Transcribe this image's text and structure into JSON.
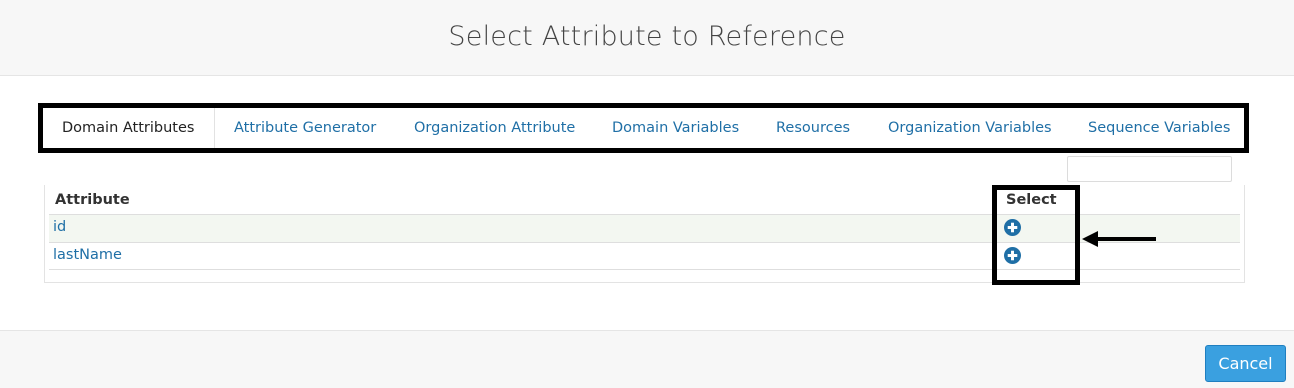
{
  "dialog": {
    "title": "Select Attribute to Reference"
  },
  "tabs": [
    {
      "label": "Domain Attributes",
      "active": true
    },
    {
      "label": "Attribute Generator",
      "active": false
    },
    {
      "label": "Organization Attribute",
      "active": false
    },
    {
      "label": "Domain Variables",
      "active": false
    },
    {
      "label": "Resources",
      "active": false
    },
    {
      "label": "Organization Variables",
      "active": false
    },
    {
      "label": "Sequence Variables",
      "active": false
    }
  ],
  "filter": {
    "value": "",
    "placeholder": ""
  },
  "table": {
    "columns": [
      "Attribute",
      "Select"
    ],
    "rows": [
      {
        "attribute": "id",
        "select_icon": "plus-circle-icon"
      },
      {
        "attribute": "lastName",
        "select_icon": "plus-circle-icon"
      }
    ]
  },
  "footer": {
    "cancel_label": "Cancel"
  },
  "colors": {
    "link": "#1f6fa6",
    "primary_button": "#3aa0e0",
    "annotation": "#000000",
    "row_highlight": "#f3f7f1"
  }
}
